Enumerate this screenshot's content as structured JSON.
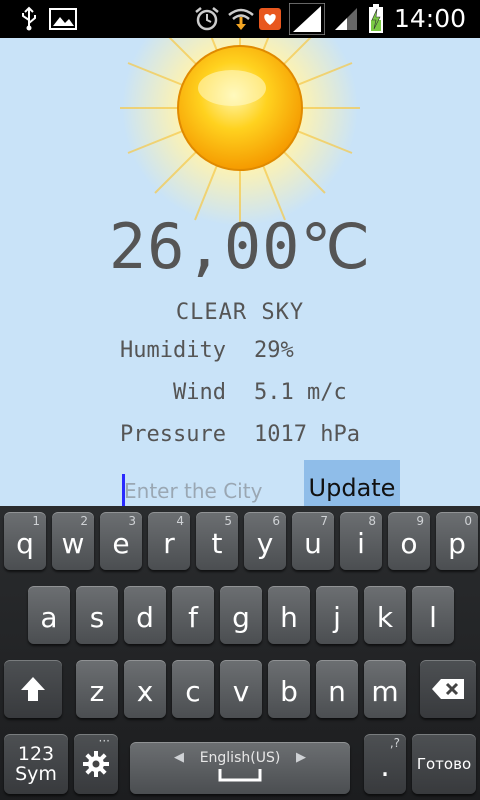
{
  "status_bar": {
    "time": "14:00",
    "icons": [
      "usb-icon",
      "gallery-icon",
      "alarm-icon",
      "wifi-download-icon",
      "heart-notification-icon",
      "signal-full-icon",
      "signal-partial-icon",
      "battery-charging-icon"
    ]
  },
  "weather": {
    "temperature": "26,00℃",
    "description": "CLEAR SKY",
    "humidity_label": "Humidity",
    "humidity_value": "29%",
    "wind_label": "Wind",
    "wind_value": "5.1 m/c",
    "pressure_label": "Pressure",
    "pressure_value": "1017 hPa",
    "icon": "sun-icon"
  },
  "city_input": {
    "placeholder": "Enter the City",
    "value": ""
  },
  "update_button": {
    "label": "Update"
  },
  "keyboard": {
    "row1": [
      {
        "ch": "q",
        "hint": "1"
      },
      {
        "ch": "w",
        "hint": "2"
      },
      {
        "ch": "e",
        "hint": "3"
      },
      {
        "ch": "r",
        "hint": "4"
      },
      {
        "ch": "t",
        "hint": "5"
      },
      {
        "ch": "y",
        "hint": "6"
      },
      {
        "ch": "u",
        "hint": "7"
      },
      {
        "ch": "i",
        "hint": "8"
      },
      {
        "ch": "o",
        "hint": "9"
      },
      {
        "ch": "p",
        "hint": "0"
      }
    ],
    "row2": [
      "a",
      "s",
      "d",
      "f",
      "g",
      "h",
      "j",
      "k",
      "l"
    ],
    "row3": [
      "z",
      "x",
      "c",
      "v",
      "b",
      "n",
      "m"
    ],
    "sym_top": "123",
    "sym_bottom": "Sym",
    "space_label": "English(US)",
    "period": ".",
    "period_hint": ",?",
    "done_label": "Готово",
    "colors": {
      "accent_cursor": "#2a2aff",
      "update_bg": "#8fbde9",
      "app_bg": "#c9e3f8"
    }
  }
}
